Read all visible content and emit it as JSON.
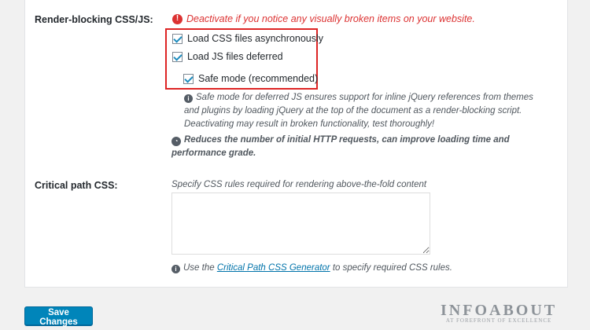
{
  "render_blocking": {
    "label": "Render-blocking CSS/JS:",
    "warning": "Deactivate if you notice any visually broken items on your website.",
    "options": [
      {
        "label": "Load CSS files asynchronously",
        "checked": true
      },
      {
        "label": "Load JS files deferred",
        "checked": true
      },
      {
        "label": "Safe mode (recommended)",
        "checked": true
      }
    ],
    "safe_mode_info": [
      "Safe mode for deferred JS ensures support for inline jQuery references from themes",
      "and plugins by loading jQuery at the top of the document as a render-blocking script.",
      "Deactivating may result in broken functionality, test thoroughly!"
    ],
    "benefit_info": [
      "Reduces the number of initial HTTP requests, can improve loading time and",
      "performance grade."
    ]
  },
  "critical_css": {
    "label": "Critical path CSS:",
    "description": "Specify CSS rules required for rendering above-the-fold content",
    "value": "",
    "hint_prefix": "Use the ",
    "hint_link": "Critical Path CSS Generator",
    "hint_suffix": " to specify required CSS rules."
  },
  "save_button": "Save Changes",
  "watermark": {
    "name": "INFOABOUT",
    "tagline": "AT FOREFRONT OF EXCELLENCE"
  },
  "colors": {
    "warning": "#dc3232",
    "highlight_border": "#dd2424",
    "primary_button": "#0085ba",
    "link": "#0073aa"
  }
}
